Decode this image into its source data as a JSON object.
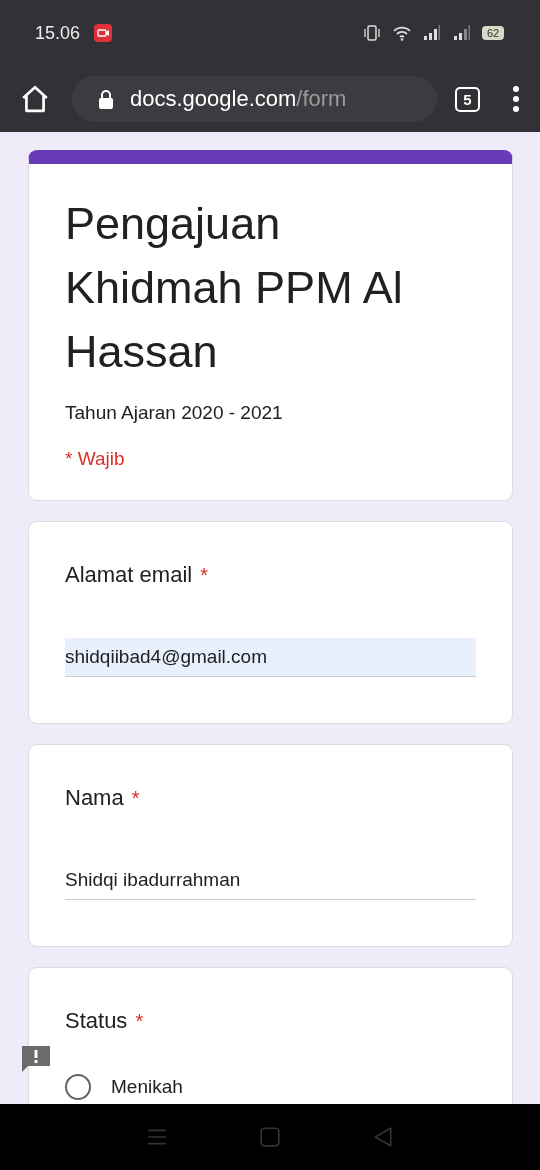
{
  "status_bar": {
    "time": "15.06",
    "battery": "62"
  },
  "browser": {
    "url_host": "docs.google.com",
    "url_path": "/form",
    "tab_count": "5"
  },
  "form": {
    "title": "Pengajuan Khidmah PPM Al Hassan",
    "description": "Tahun Ajaran 2020 - 2021",
    "required_note": "* Wajib"
  },
  "questions": [
    {
      "kind": "text",
      "label": "Alamat email",
      "required_mark": "*",
      "value": "shidqiibad4@gmail.com",
      "autofilled": true
    },
    {
      "kind": "text",
      "label": "Nama",
      "required_mark": "*",
      "value": "Shidqi ibadurrahman",
      "autofilled": false
    },
    {
      "kind": "radio",
      "label": "Status",
      "required_mark": "*",
      "options": [
        {
          "label": "Menikah",
          "selected": false
        }
      ]
    }
  ]
}
